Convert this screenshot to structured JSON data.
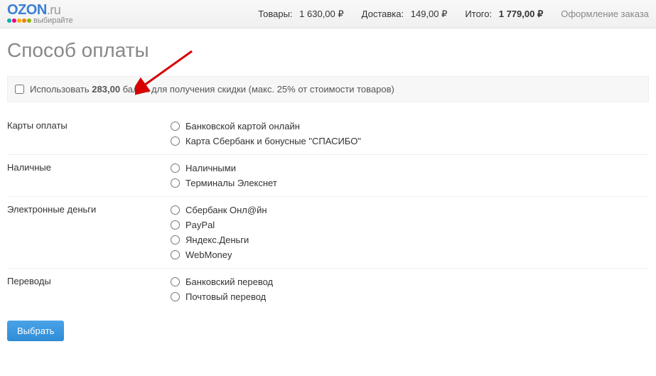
{
  "logo": {
    "tagline": "выбирайте"
  },
  "header": {
    "goods_label": "Товары:",
    "goods_price": "1 630,00",
    "delivery_label": "Доставка:",
    "delivery_price": "149,00",
    "total_label": "Итого:",
    "total_price": "1 779,00",
    "currency": "₽",
    "checkout_link": "Оформление заказа"
  },
  "title": "Способ оплаты",
  "points": {
    "prefix": "Использовать ",
    "amount": "283,00",
    "suffix": " балла для получения скидки (макс. 25% от стоимости товаров)"
  },
  "sections": [
    {
      "label": "Карты оплаты",
      "options": [
        "Банковской картой онлайн",
        "Карта Сбербанк и бонусные \"СПАСИБО\""
      ]
    },
    {
      "label": "Наличные",
      "options": [
        "Наличными",
        "Терминалы Элекснет"
      ]
    },
    {
      "label": "Электронные деньги",
      "options": [
        "Сбербанк Онл@йн",
        "PayPal",
        "Яндекс.Деньги",
        "WebMoney"
      ]
    },
    {
      "label": "Переводы",
      "options": [
        "Банковский перевод",
        "Почтовый перевод"
      ]
    }
  ],
  "submit": "Выбрать"
}
